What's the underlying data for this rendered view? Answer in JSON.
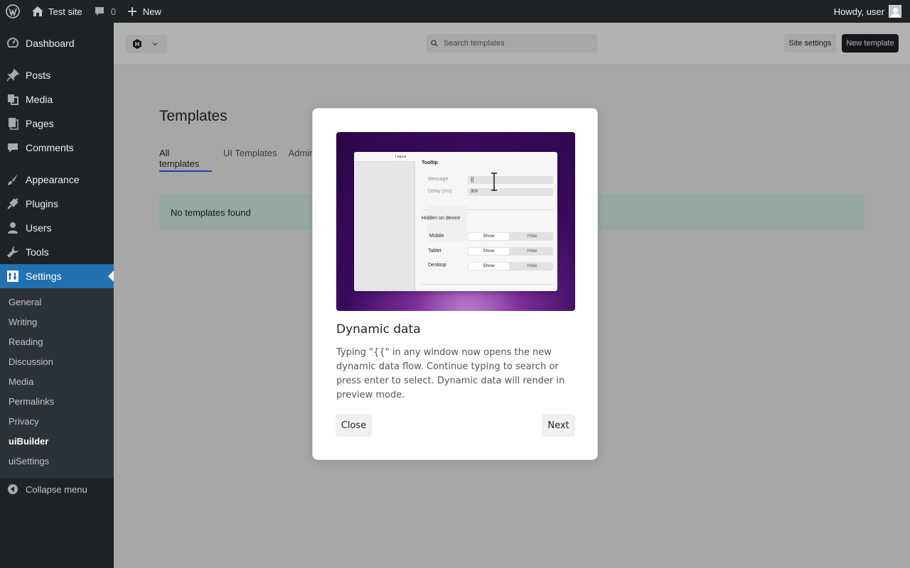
{
  "adminbar": {
    "site_name": "Test site",
    "comments_count": "0",
    "new_label": "New",
    "howdy": "Howdy, user"
  },
  "sidebar": {
    "items": [
      {
        "label": "Dashboard",
        "icon": "dashboard-icon"
      },
      {
        "label": "Posts",
        "icon": "pin-icon"
      },
      {
        "label": "Media",
        "icon": "media-icon"
      },
      {
        "label": "Pages",
        "icon": "pages-icon"
      },
      {
        "label": "Comments",
        "icon": "comment-icon"
      },
      {
        "label": "Appearance",
        "icon": "brush-icon"
      },
      {
        "label": "Plugins",
        "icon": "plug-icon"
      },
      {
        "label": "Users",
        "icon": "user-icon"
      },
      {
        "label": "Tools",
        "icon": "wrench-icon"
      },
      {
        "label": "Settings",
        "icon": "sliders-icon"
      }
    ],
    "submenu": [
      "General",
      "Writing",
      "Reading",
      "Discussion",
      "Media",
      "Permalinks",
      "Privacy",
      "uiBuilder",
      "uiSettings"
    ],
    "current_submenu": "uiBuilder",
    "collapse_label": "Collapse menu"
  },
  "topbar": {
    "search_placeholder": "Search templates",
    "site_settings_label": "Site settings",
    "new_template_label": "New template"
  },
  "main": {
    "title": "Templates",
    "tabs": [
      "All templates",
      "UI Templates",
      "Admin"
    ],
    "notice": "No templates found"
  },
  "modal": {
    "title": "Dynamic data",
    "body": "Typing \"{{\" in any window now opens the new dynamic data flow. Continue typing to search or press enter to select. Dynamic data will render in preview mode.",
    "close_label": "Close",
    "next_label": "Next",
    "preview": {
      "logout": "Logout",
      "panel_title": "Tooltip",
      "message_label": "Message",
      "message_value": "{{",
      "delay_label": "Delay (ms)",
      "delay_value": "300",
      "section": "Hidden on device",
      "devices": [
        "Mobile",
        "Tablet",
        "Desktop"
      ],
      "show": "Show",
      "hide": "Hide"
    }
  },
  "colors": {
    "admin_dark": "#1d2327",
    "accent_blue": "#2271b1",
    "tab_underline": "#3858e9",
    "notice_bg": "#d8f0ea"
  }
}
